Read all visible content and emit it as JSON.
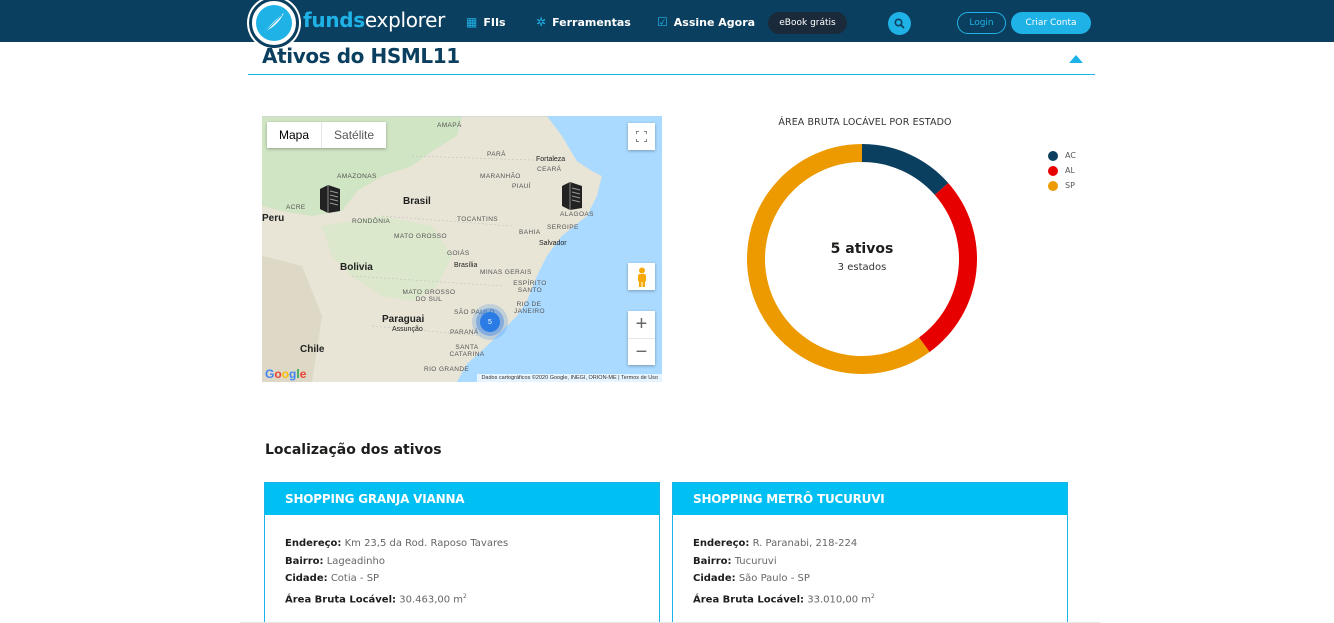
{
  "brand": {
    "name_part1": "funds",
    "name_part2": "explorer"
  },
  "nav": {
    "fiis": "FIIs",
    "ferramentas": "Ferramentas",
    "assine": "Assine Agora",
    "ebook": "eBook grátis",
    "login": "Login",
    "signup": "Criar Conta"
  },
  "section": {
    "title": "Ativos do HSML11"
  },
  "map": {
    "type_map": "Mapa",
    "type_satellite": "Satélite",
    "cluster_count": "5",
    "labels": {
      "brasil": "Brasil",
      "bolivia": "Bolivia",
      "paraguai": "Paraguai",
      "chile": "Chile",
      "peru": "Peru",
      "amapa": "AMAPÁ",
      "para": "PARÁ",
      "amazonas": "AMAZONAS",
      "maranhao": "MARANHÃO",
      "piaui": "PIAUÍ",
      "ceara": "CEARÁ",
      "fortaleza": "Fortaleza",
      "rondonia": "RONDÔNIA",
      "tocantins": "TOCANTINS",
      "bahia": "BAHIA",
      "sergipe": "SERGIPE",
      "alagoas": "ALAGOAS",
      "salvador": "Salvador",
      "mato_grosso": "MATO GROSSO",
      "brasilia": "Brasília",
      "goias": "GOIÁS",
      "minas_gerais": "MINAS GERAIS",
      "mato_grosso_do_sul": "MATO GROSSO DO SUL",
      "espirito_santo": "ESPÍRITO SANTO",
      "rio_de_janeiro": "RIO DE JANEIRO",
      "sao_paulo": "SÃO PAULO",
      "assuncao": "Assunção",
      "parana": "PARANÁ",
      "santa_catarina": "SANTA CATARINA",
      "rio_grande": "RIO GRANDE",
      "acre": "ACRE"
    },
    "google": "Google",
    "attribution": "Dados cartográficos ©2020 Google, INEGI, ORION-ME  |  Termos de Uso"
  },
  "chart_data": {
    "type": "pie",
    "title": "ÁREA BRUTA LOCÁVEL POR ESTADO",
    "categories": [
      "AC",
      "AL",
      "SP"
    ],
    "values": [
      13.5,
      26.5,
      60.0
    ],
    "colors": [
      "#0b3f5f",
      "#e60000",
      "#ec9a00"
    ],
    "center_main": "5 ativos",
    "center_sub": "3 estados",
    "legend_position": "top-right"
  },
  "location": {
    "title": "Localização dos ativos",
    "label_endereco": "Endereço:",
    "label_bairro": "Bairro:",
    "label_cidade": "Cidade:",
    "label_area": "Área Bruta Locável:",
    "unit_m": "m",
    "unit_exp": "2",
    "cards": [
      {
        "name": "SHOPPING GRANJA VIANNA",
        "endereco": "Km 23,5 da Rod. Raposo Tavares",
        "bairro": "Lageadinho",
        "cidade": "Cotia - SP",
        "area": "30.463,00"
      },
      {
        "name": "SHOPPING METRÔ TUCURUVI",
        "endereco": "R. Paranabi, 218-224",
        "bairro": "Tucuruvi",
        "cidade": "São Paulo - SP",
        "area": "33.010,00"
      }
    ]
  }
}
